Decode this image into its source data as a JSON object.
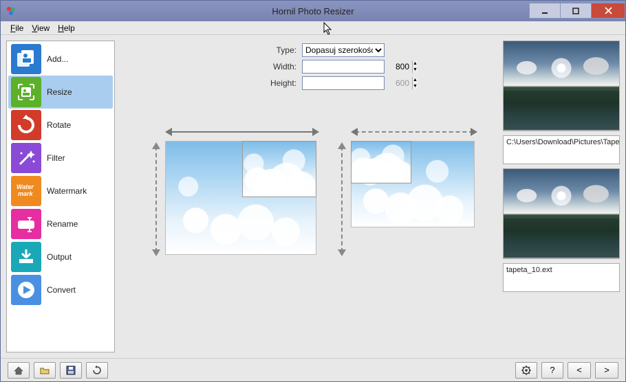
{
  "window": {
    "title": "Hornil Photo Resizer"
  },
  "menubar": {
    "file": "File",
    "view": "View",
    "help": "Help"
  },
  "sidebar": {
    "items": [
      {
        "label": "Add...",
        "color": "#2a7ad0",
        "icon": "add"
      },
      {
        "label": "Resize",
        "color": "#5cb02a",
        "icon": "resize",
        "selected": true
      },
      {
        "label": "Rotate",
        "color": "#d23a2a",
        "icon": "rotate"
      },
      {
        "label": "Filter",
        "color": "#8a4ad6",
        "icon": "wand"
      },
      {
        "label": "Watermark",
        "color": "#f08a20",
        "icon": "watermark"
      },
      {
        "label": "Rename",
        "color": "#e62ea0",
        "icon": "rename"
      },
      {
        "label": "Output",
        "color": "#1aa8b8",
        "icon": "output"
      },
      {
        "label": "Convert",
        "color": "#4a90e2",
        "icon": "play"
      }
    ]
  },
  "form": {
    "type_label": "Type:",
    "type_value": "Dopasuj szerokość",
    "width_label": "Width:",
    "width_value": "800",
    "height_label": "Height:",
    "height_value": "600"
  },
  "previews": {
    "caption1": "C:\\Users\\Download\\Pictures\\Tapet",
    "caption2": "tapeta_10.ext"
  },
  "bottom": {
    "home": "⌂",
    "open": "📂",
    "save": "💾",
    "refresh": "↻",
    "gear": "⚙",
    "help": "?",
    "prev": "<",
    "next": ">"
  }
}
